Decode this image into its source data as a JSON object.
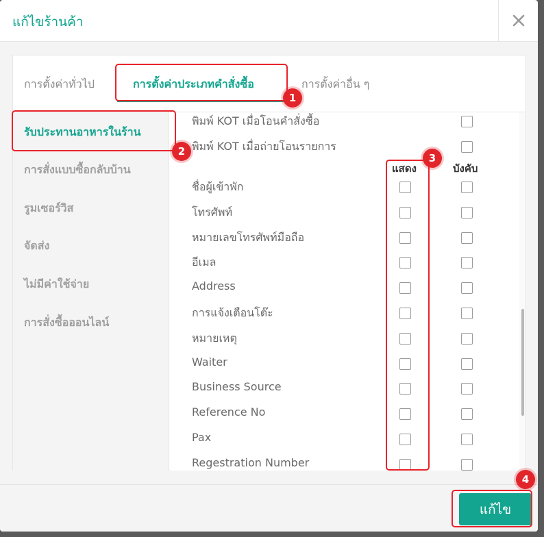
{
  "dialog": {
    "title": "แก้ไขร้านค้า"
  },
  "tabs": [
    {
      "label": "การตั้งค่าทั่วไป",
      "active": false
    },
    {
      "label": "การตั้งค่าประเภทคำสั่งซื้อ",
      "active": true
    },
    {
      "label": "การตั้งค่าอื่น ๆ",
      "active": false
    }
  ],
  "sidebar": {
    "items": [
      {
        "label": "รับประทานอาหารในร้าน",
        "active": true
      },
      {
        "label": "การสั่งแบบซื้อกลับบ้าน",
        "active": false
      },
      {
        "label": "รูมเซอร์วิส",
        "active": false
      },
      {
        "label": "จัดส่ง",
        "active": false
      },
      {
        "label": "ไม่มีค่าใช้จ่าย",
        "active": false
      },
      {
        "label": "การสั่งซื้อออนไลน์",
        "active": false
      }
    ]
  },
  "content": {
    "top_rows": [
      {
        "label": "พิมพ์ KOT เมื่อโอนคำสั่งซื้อ"
      },
      {
        "label": "พิมพ์ KOT เมื่อถ่ายโอนรายการ"
      }
    ],
    "columns": {
      "show": "แสดง",
      "required": "บังคับ"
    },
    "rows": [
      {
        "label": "ชื่อผู้เข้าพัก"
      },
      {
        "label": "โทรศัพท์"
      },
      {
        "label": "หมายเลขโทรศัพท์มือถือ"
      },
      {
        "label": "อีเมล"
      },
      {
        "label": "Address"
      },
      {
        "label": "การแจ้งเตือนโต๊ะ"
      },
      {
        "label": "หมายเหตุ"
      },
      {
        "label": "Waiter"
      },
      {
        "label": "Business Source"
      },
      {
        "label": "Reference No"
      },
      {
        "label": "Pax"
      },
      {
        "label": "Regestration Number"
      }
    ]
  },
  "footer": {
    "edit_label": "แก้ไข"
  },
  "annotations": {
    "markers": [
      "1",
      "2",
      "3",
      "4"
    ],
    "color": "#e2252b"
  },
  "colors": {
    "accent": "#13a58f",
    "highlight": "#e8232a"
  }
}
